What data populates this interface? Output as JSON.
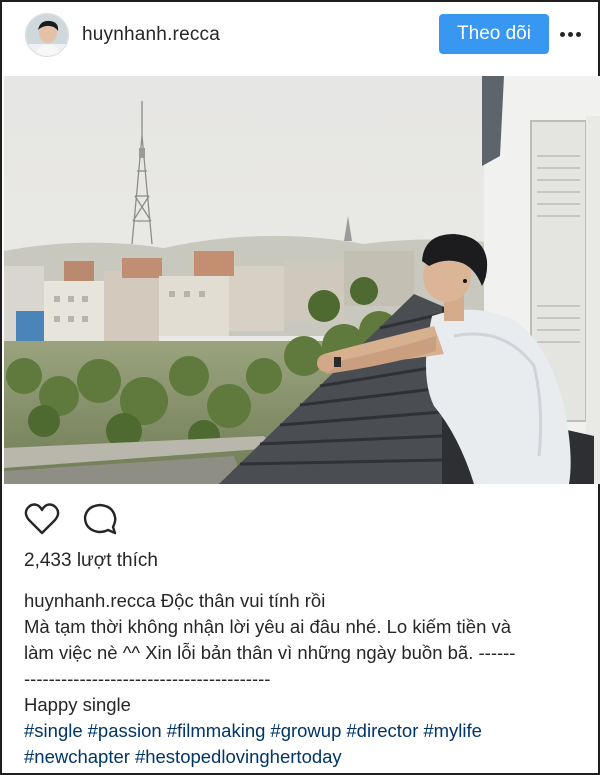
{
  "post": {
    "username": "huynhanh.recca",
    "follow_label": "Theo dõi",
    "more_label": "More options",
    "likes_text": "2,433 lượt thích",
    "caption": {
      "username": "huynhanh.recca",
      "first_line": "Độc thân vui tính rồi",
      "line2": "Mà tạm thời không nhận lời yêu ai đâu nhé. Lo kiếm tiền và",
      "line3": "làm việc nè ^^ Xin lỗi bản thân vì những ngày buồn bã. ------",
      "line4": "----------------------------------------",
      "line5": "Happy single"
    },
    "hashtags_row1": [
      "#single",
      "#passion",
      "#filmmaking",
      "#growup",
      "#director",
      "#mylife"
    ],
    "hashtags_row2": [
      "#newchapter",
      "#hestopedlovinghertoday"
    ]
  },
  "icons": {
    "like": "heart-icon",
    "comment": "comment-icon",
    "more": "ellipsis-icon"
  },
  "colors": {
    "follow_button": "#3897f0",
    "hashtag": "#003569",
    "text": "#262626"
  }
}
